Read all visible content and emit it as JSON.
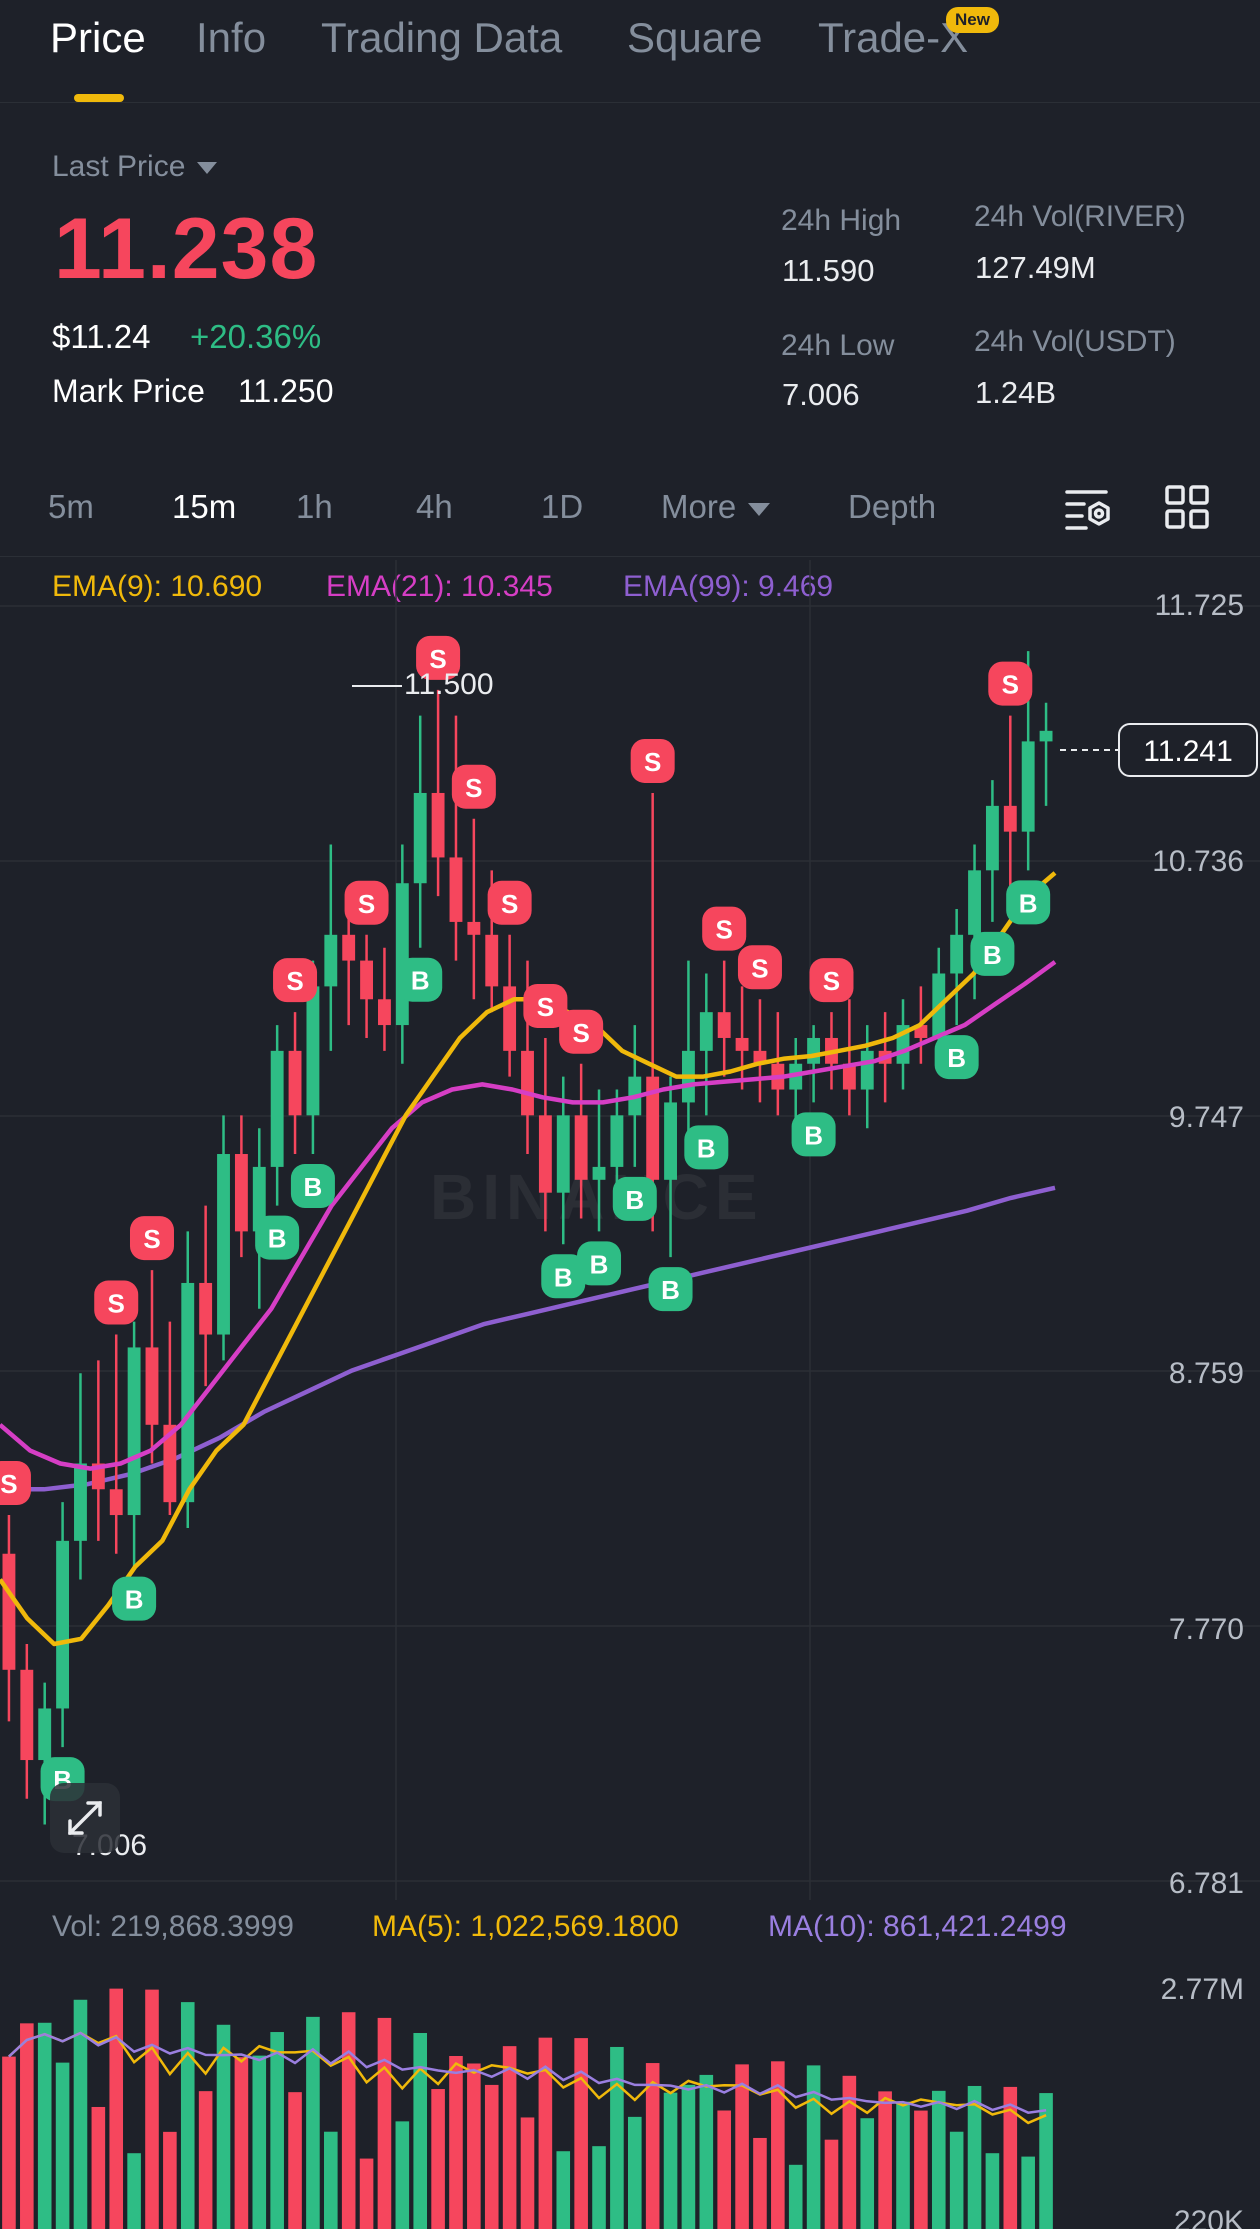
{
  "tabs": [
    {
      "label": "Price",
      "active": true
    },
    {
      "label": "Info"
    },
    {
      "label": "Trading Data"
    },
    {
      "label": "Square"
    },
    {
      "label": "Trade-X",
      "badge": "New"
    }
  ],
  "price": {
    "last_price_label": "Last Price",
    "last_price": "11.238",
    "usd_price": "$11.24",
    "change_pct": "+20.36%",
    "mark_price_label": "Mark Price",
    "mark_price": "11.250"
  },
  "stats": {
    "high_label": "24h High",
    "high": "11.590",
    "low_label": "24h Low",
    "low": "7.006",
    "vol_base_label": "24h Vol(RIVER)",
    "vol_base": "127.49M",
    "vol_quote_label": "24h Vol(USDT)",
    "vol_quote": "1.24B"
  },
  "intervals": [
    "5m",
    "15m",
    "1h",
    "4h",
    "1D",
    "More",
    "Depth"
  ],
  "active_interval": "15m",
  "indicators": {
    "ema9": "EMA(9): 10.690",
    "ema21": "EMA(21): 10.345",
    "ema99": "EMA(99): 9.469"
  },
  "y_axis": [
    "11.725",
    "10.736",
    "9.747",
    "8.759",
    "7.770",
    "6.781"
  ],
  "current_price_tag": "11.241",
  "high_marker": "11.500",
  "low_marker": "7.006",
  "volume": {
    "vol": "Vol: 219,868.3999",
    "ma5": "MA(5): 1,022,569.1800",
    "ma10": "MA(10): 861,421.2499",
    "axis_top": "2.77M",
    "axis_bottom": "220K"
  },
  "watermark": "BINANCE",
  "colors": {
    "up": "#2EBD85",
    "down": "#F6465D",
    "ema9": "#F0B90B",
    "ema21": "#D63EC5",
    "ema99": "#8E5FD0",
    "ma5": "#F0B90B",
    "ma10": "#9A7FE0",
    "accent": "#F0B90B"
  },
  "chart_data": {
    "type": "candlestick",
    "ylim": [
      6.781,
      11.725
    ],
    "candles": [
      {
        "o": 8.05,
        "h": 8.2,
        "l": 7.4,
        "c": 7.6
      },
      {
        "o": 7.6,
        "h": 7.7,
        "l": 7.1,
        "c": 7.25
      },
      {
        "o": 7.25,
        "h": 7.55,
        "l": 7.0,
        "c": 7.45
      },
      {
        "o": 7.45,
        "h": 8.25,
        "l": 7.3,
        "c": 8.1
      },
      {
        "o": 8.1,
        "h": 8.75,
        "l": 7.95,
        "c": 8.4
      },
      {
        "o": 8.4,
        "h": 8.8,
        "l": 8.1,
        "c": 8.3
      },
      {
        "o": 8.3,
        "h": 8.9,
        "l": 8.05,
        "c": 8.2
      },
      {
        "o": 8.2,
        "h": 8.95,
        "l": 8.0,
        "c": 8.85
      },
      {
        "o": 8.85,
        "h": 9.15,
        "l": 8.4,
        "c": 8.55
      },
      {
        "o": 8.55,
        "h": 8.95,
        "l": 8.2,
        "c": 8.25
      },
      {
        "o": 8.25,
        "h": 9.3,
        "l": 8.15,
        "c": 9.1
      },
      {
        "o": 9.1,
        "h": 9.4,
        "l": 8.7,
        "c": 8.9
      },
      {
        "o": 8.9,
        "h": 9.75,
        "l": 8.8,
        "c": 9.6
      },
      {
        "o": 9.6,
        "h": 9.75,
        "l": 9.2,
        "c": 9.3
      },
      {
        "o": 9.3,
        "h": 9.7,
        "l": 9.0,
        "c": 9.55
      },
      {
        "o": 9.55,
        "h": 10.1,
        "l": 9.4,
        "c": 10.0
      },
      {
        "o": 10.0,
        "h": 10.15,
        "l": 9.6,
        "c": 9.75
      },
      {
        "o": 9.75,
        "h": 10.35,
        "l": 9.6,
        "c": 10.25
      },
      {
        "o": 10.25,
        "h": 10.8,
        "l": 10.0,
        "c": 10.45
      },
      {
        "o": 10.45,
        "h": 10.6,
        "l": 10.1,
        "c": 10.35
      },
      {
        "o": 10.35,
        "h": 10.45,
        "l": 10.05,
        "c": 10.2
      },
      {
        "o": 10.2,
        "h": 10.4,
        "l": 10.0,
        "c": 10.1
      },
      {
        "o": 10.1,
        "h": 10.8,
        "l": 9.95,
        "c": 10.65
      },
      {
        "o": 10.65,
        "h": 11.3,
        "l": 10.4,
        "c": 11.0
      },
      {
        "o": 11.0,
        "h": 11.4,
        "l": 10.6,
        "c": 10.75
      },
      {
        "o": 10.75,
        "h": 11.3,
        "l": 10.35,
        "c": 10.5
      },
      {
        "o": 10.5,
        "h": 10.9,
        "l": 10.2,
        "c": 10.45
      },
      {
        "o": 10.45,
        "h": 10.7,
        "l": 10.15,
        "c": 10.25
      },
      {
        "o": 10.25,
        "h": 10.45,
        "l": 9.9,
        "c": 10.0
      },
      {
        "o": 10.0,
        "h": 10.35,
        "l": 9.6,
        "c": 9.75
      },
      {
        "o": 9.75,
        "h": 10.05,
        "l": 9.3,
        "c": 9.45
      },
      {
        "o": 9.45,
        "h": 9.9,
        "l": 9.25,
        "c": 9.75
      },
      {
        "o": 9.75,
        "h": 9.95,
        "l": 9.35,
        "c": 9.5
      },
      {
        "o": 9.5,
        "h": 9.85,
        "l": 9.3,
        "c": 9.55
      },
      {
        "o": 9.55,
        "h": 9.85,
        "l": 9.4,
        "c": 9.75
      },
      {
        "o": 9.75,
        "h": 10.1,
        "l": 9.55,
        "c": 9.9
      },
      {
        "o": 9.9,
        "h": 11.0,
        "l": 9.3,
        "c": 9.5
      },
      {
        "o": 9.5,
        "h": 9.9,
        "l": 9.2,
        "c": 9.8
      },
      {
        "o": 9.8,
        "h": 10.35,
        "l": 9.6,
        "c": 10.0
      },
      {
        "o": 10.0,
        "h": 10.3,
        "l": 9.75,
        "c": 10.15
      },
      {
        "o": 10.15,
        "h": 10.35,
        "l": 9.9,
        "c": 10.05
      },
      {
        "o": 10.05,
        "h": 10.25,
        "l": 9.85,
        "c": 10.0
      },
      {
        "o": 10.0,
        "h": 10.2,
        "l": 9.8,
        "c": 9.95
      },
      {
        "o": 9.95,
        "h": 10.15,
        "l": 9.75,
        "c": 9.85
      },
      {
        "o": 9.85,
        "h": 10.05,
        "l": 9.65,
        "c": 9.95
      },
      {
        "o": 9.95,
        "h": 10.1,
        "l": 9.8,
        "c": 10.05
      },
      {
        "o": 10.05,
        "h": 10.15,
        "l": 9.85,
        "c": 9.95
      },
      {
        "o": 9.95,
        "h": 10.2,
        "l": 9.75,
        "c": 9.85
      },
      {
        "o": 9.85,
        "h": 10.1,
        "l": 9.7,
        "c": 10.0
      },
      {
        "o": 10.0,
        "h": 10.15,
        "l": 9.8,
        "c": 9.95
      },
      {
        "o": 9.95,
        "h": 10.2,
        "l": 9.85,
        "c": 10.1
      },
      {
        "o": 10.1,
        "h": 10.25,
        "l": 9.95,
        "c": 10.05
      },
      {
        "o": 10.05,
        "h": 10.4,
        "l": 9.95,
        "c": 10.3
      },
      {
        "o": 10.3,
        "h": 10.55,
        "l": 10.1,
        "c": 10.45
      },
      {
        "o": 10.45,
        "h": 10.8,
        "l": 10.2,
        "c": 10.7
      },
      {
        "o": 10.7,
        "h": 11.05,
        "l": 10.5,
        "c": 10.95
      },
      {
        "o": 10.95,
        "h": 11.3,
        "l": 10.6,
        "c": 10.85
      },
      {
        "o": 10.85,
        "h": 11.55,
        "l": 10.7,
        "c": 11.2
      },
      {
        "o": 11.2,
        "h": 11.35,
        "l": 10.95,
        "c": 11.241
      }
    ],
    "ema9": [
      7.95,
      7.8,
      7.7,
      7.72,
      7.85,
      8.0,
      8.1,
      8.3,
      8.45,
      8.55,
      8.75,
      8.95,
      9.15,
      9.35,
      9.55,
      9.75,
      9.9,
      10.05,
      10.15,
      10.2,
      10.2,
      10.15,
      10.1,
      10.0,
      9.95,
      9.9,
      9.9,
      9.92,
      9.95,
      9.97,
      9.98,
      10.0,
      10.02,
      10.05,
      10.1,
      10.2,
      10.3,
      10.45,
      10.6,
      10.69
    ],
    "ema21": [
      8.55,
      8.45,
      8.4,
      8.38,
      8.4,
      8.45,
      8.55,
      8.7,
      8.85,
      9.0,
      9.2,
      9.4,
      9.55,
      9.7,
      9.8,
      9.85,
      9.87,
      9.85,
      9.82,
      9.8,
      9.8,
      9.82,
      9.85,
      9.87,
      9.88,
      9.89,
      9.9,
      9.92,
      9.94,
      9.96,
      10.0,
      10.05,
      10.1,
      10.18,
      10.26,
      10.345
    ],
    "ema99": [
      8.3,
      8.3,
      8.32,
      8.36,
      8.42,
      8.5,
      8.6,
      8.68,
      8.76,
      8.82,
      8.88,
      8.94,
      8.98,
      9.02,
      9.06,
      9.1,
      9.14,
      9.18,
      9.22,
      9.26,
      9.3,
      9.34,
      9.38,
      9.43,
      9.469
    ]
  }
}
